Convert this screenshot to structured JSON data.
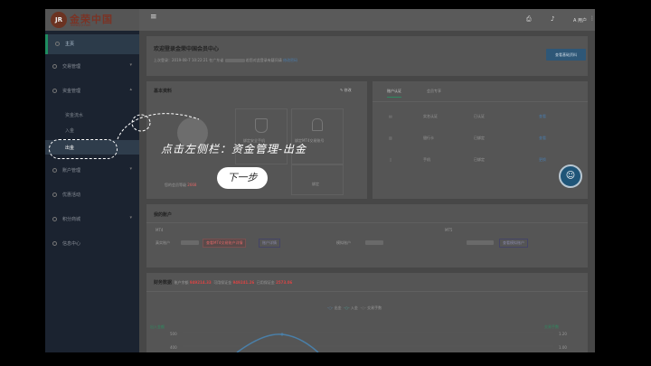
{
  "logo": {
    "mark": "JR",
    "name": "金荣中国",
    "sub": "www.jrjr.com"
  },
  "nav": {
    "home": "主页",
    "items": [
      {
        "label": "交易管理"
      },
      {
        "label": "资金管理"
      },
      {
        "label": "账户管理"
      },
      {
        "label": "优惠活动"
      },
      {
        "label": "积分商城"
      },
      {
        "label": "信息中心"
      }
    ],
    "funds_sub": [
      "资金流水",
      "入金",
      "出金"
    ]
  },
  "topbar": {
    "menu": "≡",
    "user": "A 用户"
  },
  "welcome": {
    "title": "欢迎登录金荣中国会员中心",
    "last_login": "上次登录：2019-08-7 10:22:21 在广东省",
    "last_login_tail": "若您对此登录有疑问请",
    "link": "修改密码",
    "button": "查看基础资料"
  },
  "basic": {
    "title": "基本资料",
    "edit": "修改",
    "verify1": "绑定安全手机",
    "verify2": "绑定MT4交易账号",
    "verify3": "绑定",
    "level_prefix": "您的会员等级",
    "level_value": "2668"
  },
  "account": {
    "tabs": [
      "账户认证",
      "会员专享"
    ],
    "rows": [
      {
        "label": "实名认证",
        "status": "已认证",
        "action": "查看"
      },
      {
        "label": "银行卡",
        "status": "已绑定",
        "action": "查看"
      },
      {
        "label": "手机",
        "status": "已绑定",
        "action": "更换"
      }
    ]
  },
  "my_accounts": {
    "title": "我的账户",
    "mt4_label": "MT4",
    "mt4_field": "真实账户",
    "mt4_chip": "查看MT4交易账户详情",
    "mt4_chip2": "账户详情",
    "mt5_label": "MT5",
    "mt5_field": "模拟账户",
    "mt5_chip": "查看模拟账户"
  },
  "finance": {
    "title": "财务数据",
    "stats": [
      {
        "label": "账户余额",
        "value": "949214.33"
      },
      {
        "label": "可用保证金",
        "value": "949241.26"
      },
      {
        "label": "已用保证金",
        "value": "2573.06"
      }
    ],
    "legend": [
      "出金",
      "入金",
      "交易手数"
    ],
    "left_axis": "出入金额",
    "right_axis": "交易手数",
    "ticks_left": [
      "500",
      "400"
    ],
    "ticks_right": [
      "1.20",
      "1.00"
    ]
  },
  "overlay": {
    "instruction": "点击左侧栏：资金管理-出金",
    "next": "下一步"
  },
  "colors": {
    "sidebar": "#1b2330",
    "accent": "#1e8c60",
    "blue": "#2e5777",
    "red": "#d64545"
  }
}
